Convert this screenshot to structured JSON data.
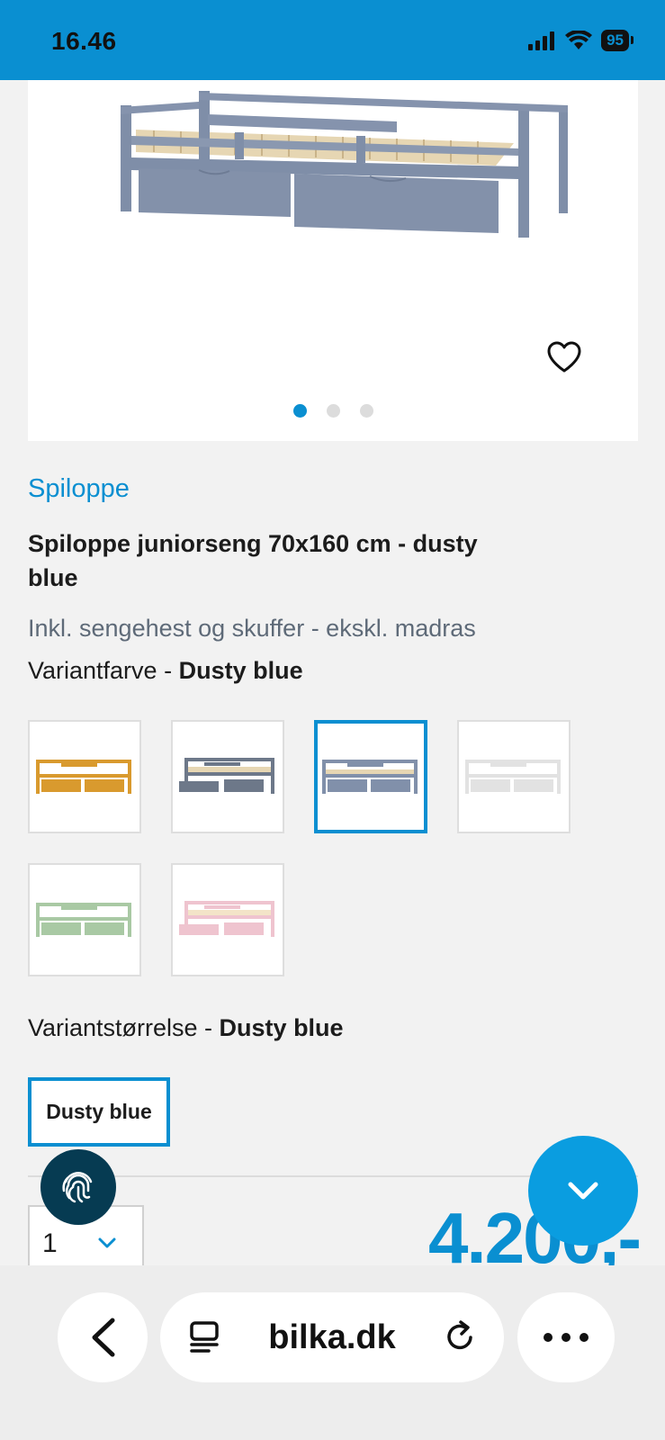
{
  "status_bar": {
    "time": "16.46",
    "battery": "95",
    "icons": [
      "signal-icon",
      "wifi-icon",
      "battery-icon"
    ]
  },
  "gallery": {
    "slides": 3,
    "active_slide": 1,
    "favorite_icon": "heart-icon"
  },
  "product": {
    "brand": "Spiloppe",
    "title": "Spiloppe juniorseng 70x160 cm - dusty blue",
    "subtitle": "Inkl. sengehest og skuffer - ekskl. madras"
  },
  "variant_color": {
    "label": "Variantfarve - ",
    "value": "Dusty blue",
    "swatches": [
      {
        "color": "#d99a2e"
      },
      {
        "color": "#6d7889"
      },
      {
        "color": "#8190aa",
        "selected": true
      },
      {
        "color": "#ebebeb"
      },
      {
        "color": "#a9c9a4"
      },
      {
        "color": "#efc4cf"
      }
    ]
  },
  "variant_size": {
    "label": "Variantstørrelse - ",
    "value": "Dusty blue",
    "option": "Dusty blue"
  },
  "quantity": {
    "value": "1"
  },
  "price": {
    "value": "4.200,-"
  },
  "browser": {
    "url": "bilka.dk",
    "more_label": "•••"
  },
  "colors": {
    "accent": "#0a8fd1",
    "fingerprint_bg": "#063b52"
  }
}
